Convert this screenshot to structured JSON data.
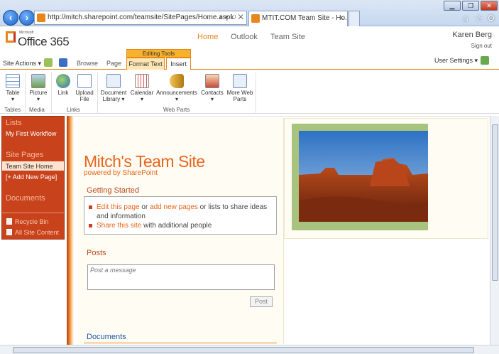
{
  "browser": {
    "url": "http://mitch.sharepoint.com/teamsite/SitePages/Home.aspx",
    "tab_title": "MTIT.COM Team Site - Ho...",
    "tab_close": "×",
    "search_glyph": "⌕ ▾ ↻ ✕"
  },
  "header": {
    "logo_small": "Microsoft",
    "logo_text": "Office 365",
    "nav": [
      "Home",
      "Outlook",
      "Team Site"
    ],
    "user_name": "Karen Berg",
    "sign_out": "Sign out"
  },
  "ribbon": {
    "site_actions": "Site Actions ▾",
    "tabs": [
      "Browse",
      "Page"
    ],
    "contextual_group": "Editing Tools",
    "format_text": "Format Text",
    "insert": "Insert",
    "user_settings": "User Settings ▾",
    "buttons": {
      "table": "Table",
      "picture": "Picture",
      "link": "Link",
      "upload": "Upload File",
      "doclib": "Document Library ▾",
      "calendar": "Calendar",
      "announcements": "Announcements",
      "contacts": "Contacts",
      "more": "More Web Parts"
    },
    "groups": [
      "Tables",
      "Media",
      "Links",
      "Web Parts"
    ]
  },
  "leftnav": {
    "lists_heading": "Lists",
    "workflow": "My First Workflow",
    "site_pages_heading": "Site Pages",
    "home": "Team Site Home",
    "add_page": "[+ Add New Page]",
    "documents_heading": "Documents",
    "recycle": "Recycle Bin",
    "all_content": "All Site Content"
  },
  "main": {
    "title": "Mitch's Team Site",
    "powered": "powered by SharePoint",
    "getting_started": "Getting Started",
    "line1_link1": "Edit this page",
    "line1_or": " or ",
    "line1_link2": "add new pages",
    "line1_rest": " or lists to share ideas",
    "line1_cont": "and information",
    "line2_link": "Share this site",
    "line2_rest": " with additional people",
    "posts_heading": "Posts",
    "post_placeholder": "Post a message",
    "post_button": "Post",
    "documents_heading": "Documents"
  },
  "colors": {
    "accent": "#e8651c",
    "nav_bg": "#c8421c",
    "frame": "#a8c37e"
  }
}
